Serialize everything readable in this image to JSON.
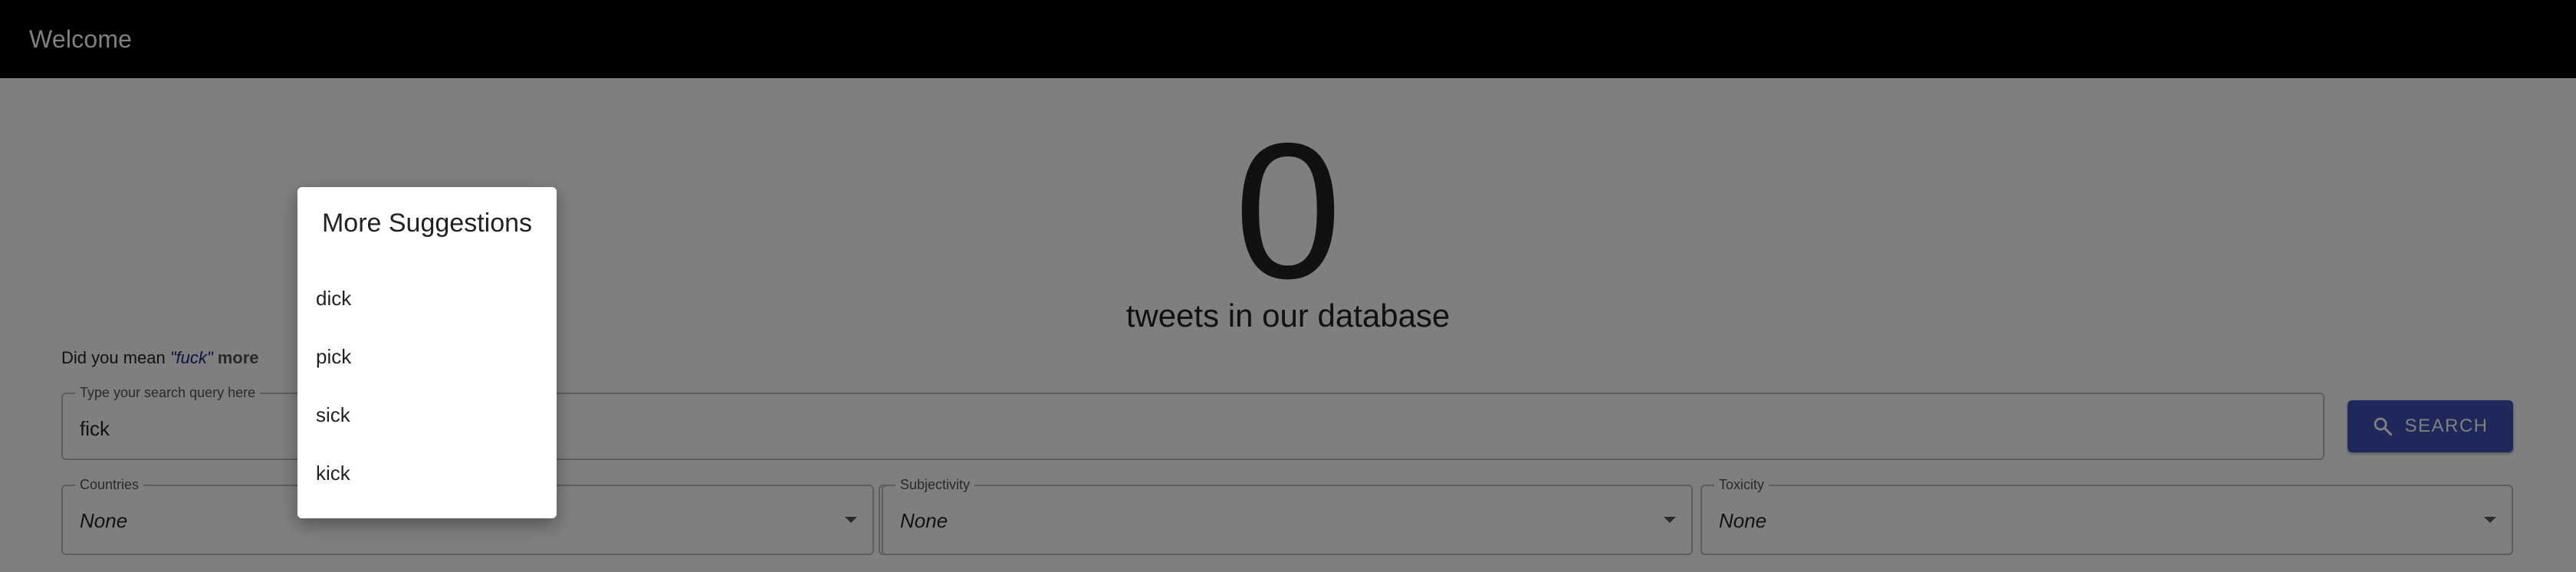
{
  "appbar": {
    "title": "Welcome"
  },
  "stats": {
    "count": "0",
    "caption": "tweets in our database"
  },
  "did_you_mean": {
    "prefix": "Did you mean",
    "suggestion": "\"fuck\"",
    "more_label": "more"
  },
  "search": {
    "label": "Type your search query here",
    "value": "fick",
    "button_label": "SEARCH"
  },
  "filters": [
    {
      "label": "Countries",
      "value": "None"
    },
    {
      "label": "",
      "value": ""
    },
    {
      "label": "Subjectivity",
      "value": "None"
    },
    {
      "label": "Toxicity",
      "value": "None"
    }
  ],
  "popover": {
    "title": "More Suggestions",
    "items": [
      "dick",
      "pick",
      "sick",
      "kick"
    ]
  },
  "colors": {
    "appbar": "#000000",
    "accent": "#3f51b5",
    "suggestion_link": "#1a237e"
  },
  "icons": {
    "search_button": "search-icon",
    "select_arrow": "caret-down-icon"
  }
}
